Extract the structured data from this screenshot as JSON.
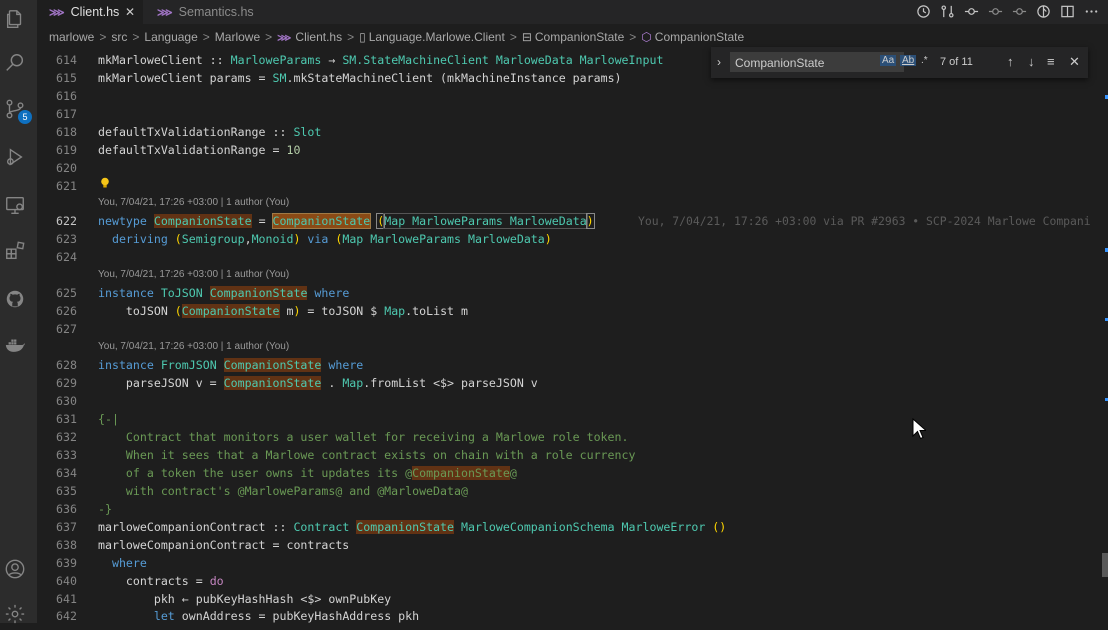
{
  "activity_bar": {
    "items": [
      "explorer-icon",
      "search-icon",
      "source-control-icon",
      "run-debug-icon",
      "remote-explorer-icon",
      "extensions-icon",
      "github-icon",
      "docker-icon"
    ],
    "source_control_badge": "5",
    "bottom": [
      "account-icon",
      "settings-gear-icon"
    ]
  },
  "tabs": [
    {
      "label": "Client.hs",
      "active": true,
      "icon": "haskell-icon"
    },
    {
      "label": "Semantics.hs",
      "active": false,
      "icon": "haskell-icon"
    }
  ],
  "tab_close_glyph": "✕",
  "breadcrumbs": {
    "items": [
      "marlowe",
      "src",
      "Language",
      "Marlowe",
      "Client.hs",
      "Language.Marlowe.Client",
      "CompanionState",
      "CompanionState"
    ],
    "separator": ">"
  },
  "find_widget": {
    "query": "CompanionState",
    "match_case_label": "Aa",
    "whole_word_label": "Ab",
    "regex_label": ".*",
    "count": "7 of 11"
  },
  "code_lens": {
    "l622": "You, 7/04/21, 17:26 +03:00 | 1 author (You)",
    "l625": "You, 7/04/21, 17:26 +03:00 | 1 author (You)",
    "l628": "You, 7/04/21, 17:26 +03:00 | 1 author (You)"
  },
  "inline_blame": "You, 7/04/21, 17:26 +03:00 via PR #2963 • SCP-2024 Marlowe Compani",
  "line_numbers": [
    "614",
    "615",
    "616",
    "617",
    "618",
    "619",
    "620",
    "621",
    "622",
    "623",
    "624",
    "625",
    "626",
    "627",
    "628",
    "629",
    "630",
    "631",
    "632",
    "633",
    "634",
    "635",
    "636",
    "637",
    "638",
    "639",
    "640",
    "641",
    "642"
  ],
  "code": {
    "l614": [
      "mkMarloweClient :: ",
      "MarloweParams",
      " → ",
      "SM",
      ".StateMachineClient ",
      "MarloweData",
      " ",
      "MarloweInput"
    ],
    "l615": [
      "mkMarloweClient params = ",
      "SM",
      ".mkStateMachineClient (mkMachineInstance params)"
    ],
    "l618": [
      "defaultTxValidationRange :: ",
      "Slot"
    ],
    "l619": [
      "defaultTxValidationRange = ",
      "10"
    ],
    "l622": [
      "newtype",
      " ",
      "CompanionState",
      " = ",
      "CompanionState",
      " ",
      "(",
      "Map MarloweParams MarloweData",
      ")"
    ],
    "l623": [
      "  deriving ",
      "(",
      "Semigroup",
      "Monoid",
      ")",
      " via ",
      "(",
      "Map MarloweParams MarloweData",
      ")"
    ],
    "l625": [
      "instance",
      " ",
      "ToJSON",
      " ",
      "CompanionState",
      " ",
      "where"
    ],
    "l626": [
      "    toJSON ",
      "(",
      "CompanionState",
      " m",
      ")",
      " = toJSON $ ",
      "Map",
      ".toList m"
    ],
    "l628": [
      "instance",
      " ",
      "FromJSON",
      " ",
      "CompanionState",
      " ",
      "where"
    ],
    "l629": [
      "    parseJSON v = ",
      "CompanionState",
      " . ",
      "Map",
      ".fromList <$> parseJSON v"
    ],
    "l631": [
      "{-|"
    ],
    "l632": [
      "    Contract that monitors a user wallet for receiving a Marlowe role token."
    ],
    "l633": [
      "    When it sees that a Marlowe contract exists on chain with a role currency"
    ],
    "l634": [
      "    of a token the user owns it updates its @",
      "CompanionState",
      "@"
    ],
    "l635": [
      "    with contract's @MarloweParams@ and @MarloweData@"
    ],
    "l636": [
      "-}"
    ],
    "l637": [
      "marloweCompanionContract :: ",
      "Contract",
      " ",
      "CompanionState",
      " ",
      "MarloweCompanionSchema",
      " ",
      "MarloweError",
      " ",
      "()"
    ],
    "l638": [
      "marloweCompanionContract = contracts"
    ],
    "l639": [
      "  where"
    ],
    "l640": [
      "    contracts = ",
      "do"
    ],
    "l641": [
      "        pkh ← pubKeyHashHash <$> ownPubKey"
    ],
    "l642": [
      "        ",
      "let",
      " ownAddress = pubKeyHashAddress pkh"
    ]
  },
  "colors": {
    "keyword": "#569cd6",
    "type": "#4ec9b0",
    "comment": "#6a9955",
    "find_highlight": "#613214",
    "accent": "#0e70c0"
  }
}
